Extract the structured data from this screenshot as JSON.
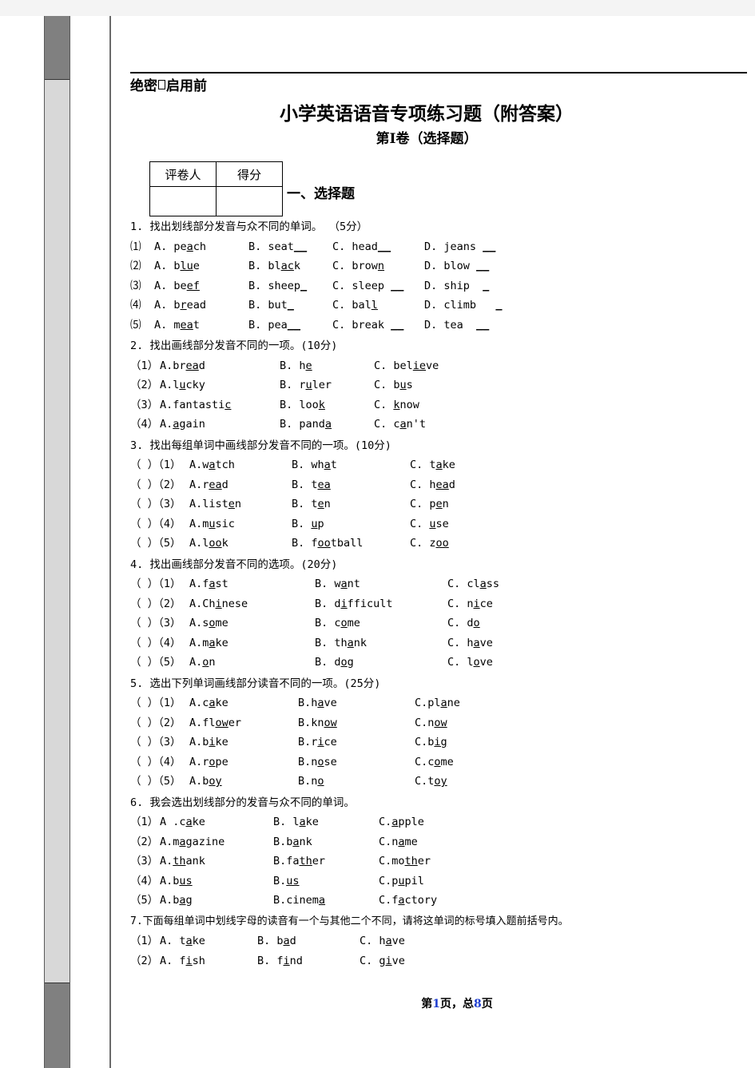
{
  "viewer": {
    "scrollbar_name": "vertical-scrollbar"
  },
  "document": {
    "secret_prefix": "绝密",
    "secret_suffix": "启用前",
    "title": "小学英语语音专项练习题（附答案）",
    "subtitle": "第I卷（选择题）",
    "section_title": "一、选择题",
    "footer_prefix": "第",
    "footer_page": "1",
    "footer_middle": "页，总",
    "footer_total": "8",
    "footer_suffix": "页"
  },
  "score_table": {
    "headers": [
      "评卷人",
      "得分"
    ],
    "values": [
      "",
      ""
    ]
  },
  "questions": [
    {
      "id": "q1",
      "head": "1. 找出划线部分发音与众不同的单词。 （5分）",
      "columns": 4,
      "group": "g1",
      "items": [
        {
          "lead": "⑴",
          "options": [
            "A. pe<u>a</u>ch",
            "B. seat<u>__</u>",
            "C. head<u>__</u>",
            "D. jeans <u>__</u>"
          ]
        },
        {
          "lead": "⑵",
          "options": [
            "A. b<u>lu</u>e",
            "B. bl<u>ac</u>k",
            "C. brow<u>n</u>",
            "D. blow <u>__</u>"
          ]
        },
        {
          "lead": "⑶",
          "options": [
            "A. be<u>ef</u>",
            "B. sheep<u>_</u>",
            "C. sleep <u>__</u>",
            "D. ship  <u>_</u>"
          ]
        },
        {
          "lead": "⑷",
          "options": [
            "A. b<u>r</u>ead",
            "B. but<u>_</u>",
            "C. bal<u>l</u>",
            "D. climb   <u>_</u>"
          ]
        },
        {
          "lead": "⑸",
          "options": [
            "A. m<u>ea</u>t",
            "B. pea<u>__</u>",
            "C. break <u>__</u>",
            "D. tea  <u>__</u>"
          ]
        }
      ]
    },
    {
      "id": "q2",
      "head": "2. 找出画线部分发音不同的一项。(10分)",
      "columns": 3,
      "group": "g2",
      "items": [
        {
          "lead": "（1）",
          "options": [
            "A.br<u>ea</u>d",
            "B. h<u>e</u>",
            "C. bel<u>ie</u>ve"
          ]
        },
        {
          "lead": "（2）",
          "options": [
            "A.l<u>u</u>cky",
            "B. r<u>u</u>ler",
            "C. b<u>u</u>s"
          ]
        },
        {
          "lead": "（3）",
          "options": [
            "A.fantasti<u>c</u>",
            "B. loo<u>k</u>",
            "C. <u>k</u>now"
          ]
        },
        {
          "lead": "（4）",
          "options": [
            "A.<u>a</u>gain",
            "B. pand<u>a</u>",
            "C. c<u>a</u>n't"
          ]
        }
      ]
    },
    {
      "id": "q3",
      "head": "3. 找出每组单词中画线部分发音不同的一项。(10分)",
      "columns": 3,
      "group": "g3",
      "items": [
        {
          "lead": "（ ）（1）",
          "options": [
            "A.w<u>a</u>tch",
            "B. wh<u>a</u>t",
            "C. t<u>a</u>ke"
          ]
        },
        {
          "lead": "（ ）（2）",
          "options": [
            "A.r<u>ea</u>d",
            "B. t<u>ea</u>",
            "C. h<u>ea</u>d"
          ]
        },
        {
          "lead": "（ ）（3）",
          "options": [
            "A.list<u>e</u>n",
            "B. t<u>e</u>n",
            "C. p<u>e</u>n"
          ]
        },
        {
          "lead": "（ ）（4）",
          "options": [
            "A.m<u>u</u>sic",
            "B. <u>u</u>p",
            "C. <u>u</u>se"
          ]
        },
        {
          "lead": "（ ）（5）",
          "options": [
            "A.l<u>oo</u>k",
            "B. f<u>oo</u>tball",
            "C. z<u>oo</u>"
          ]
        }
      ]
    },
    {
      "id": "q4",
      "head": "4. 找出画线部分发音不同的选项。(20分)",
      "columns": 3,
      "group": "g4",
      "items": [
        {
          "lead": "（ ）（1）",
          "options": [
            "A.f<u>a</u>st",
            "B. w<u>a</u>nt",
            "C. cl<u>a</u>ss"
          ]
        },
        {
          "lead": "（ ）（2）",
          "options": [
            "A.Ch<u>i</u>nese",
            "B. d<u>i</u>fficult",
            "C. n<u>i</u>ce"
          ]
        },
        {
          "lead": "（ ）（3）",
          "options": [
            "A.s<u>o</u>me",
            "B. c<u>o</u>me",
            "C. d<u>o</u>"
          ]
        },
        {
          "lead": "（ ）（4）",
          "options": [
            "A.m<u>a</u>ke",
            "B. th<u>a</u>nk",
            "C. h<u>a</u>ve"
          ]
        },
        {
          "lead": "（ ）（5）",
          "options": [
            "A.<u>o</u>n",
            "B. d<u>o</u>g",
            "C. l<u>o</u>ve"
          ]
        }
      ]
    },
    {
      "id": "q5",
      "head": "5. 选出下列单词画线部分读音不同的一项。(25分)",
      "columns": 3,
      "group": "g5",
      "items": [
        {
          "lead": "（ ）（1）",
          "options": [
            "A.c<u>a</u>ke",
            "B.h<u>a</u>ve",
            "C.pl<u>a</u>ne"
          ]
        },
        {
          "lead": "（ ）（2）",
          "options": [
            "A.fl<u>ow</u>er",
            "B.kn<u>ow</u>",
            "C.n<u>ow</u>"
          ]
        },
        {
          "lead": "（ ）（3）",
          "options": [
            "A.b<u>i</u>ke",
            "B.r<u>i</u>ce",
            "C.b<u>ig</u>"
          ]
        },
        {
          "lead": "（ ）（4）",
          "options": [
            "A.r<u>o</u>pe",
            "B.n<u>o</u>se",
            "C.c<u>o</u>me"
          ]
        },
        {
          "lead": "（ ）（5）",
          "options": [
            "A.b<u>oy</u>",
            "B.n<u>o</u>",
            "C.t<u>oy</u>"
          ]
        }
      ]
    },
    {
      "id": "q6",
      "head": "6. 我会选出划线部分的发音与众不同的单词。",
      "columns": 3,
      "group": "g6",
      "items": [
        {
          "lead": "（1）",
          "options": [
            "A .c<u>a</u>ke",
            "B. l<u>a</u>ke",
            "C.<u>a</u>pple"
          ]
        },
        {
          "lead": "（2）",
          "options": [
            "A.m<u>a</u>gazine",
            "B.b<u>a</u>nk",
            "C.n<u>a</u>me"
          ]
        },
        {
          "lead": "（3）",
          "options": [
            "A.<u>th</u>ank",
            "B.fa<u>th</u>er",
            "C.mo<u>th</u>er"
          ]
        },
        {
          "lead": "（4）",
          "options": [
            "A.b<u>us</u>",
            "B.<u>us</u>",
            "C.p<u>u</u>pil"
          ]
        },
        {
          "lead": "（5）",
          "options": [
            "A.b<u>a</u>g",
            "B.cinem<u>a</u>",
            "C.f<u>a</u>ctory"
          ]
        }
      ]
    },
    {
      "id": "q7",
      "head": "7.下面每组单词中划线字母的读音有一个与其他二个不同，请将这单词的标号填入题前括号内。",
      "columns": 3,
      "group": "g7",
      "items": [
        {
          "lead": "（1）",
          "options": [
            "A. t<u>a</u>ke",
            "B. b<u>a</u>d",
            "C. h<u>a</u>ve"
          ]
        },
        {
          "lead": "（2）",
          "options": [
            "A. f<u>i</u>sh",
            "B. f<u>i</u>nd",
            "C. g<u>i</u>ve"
          ]
        }
      ]
    }
  ]
}
